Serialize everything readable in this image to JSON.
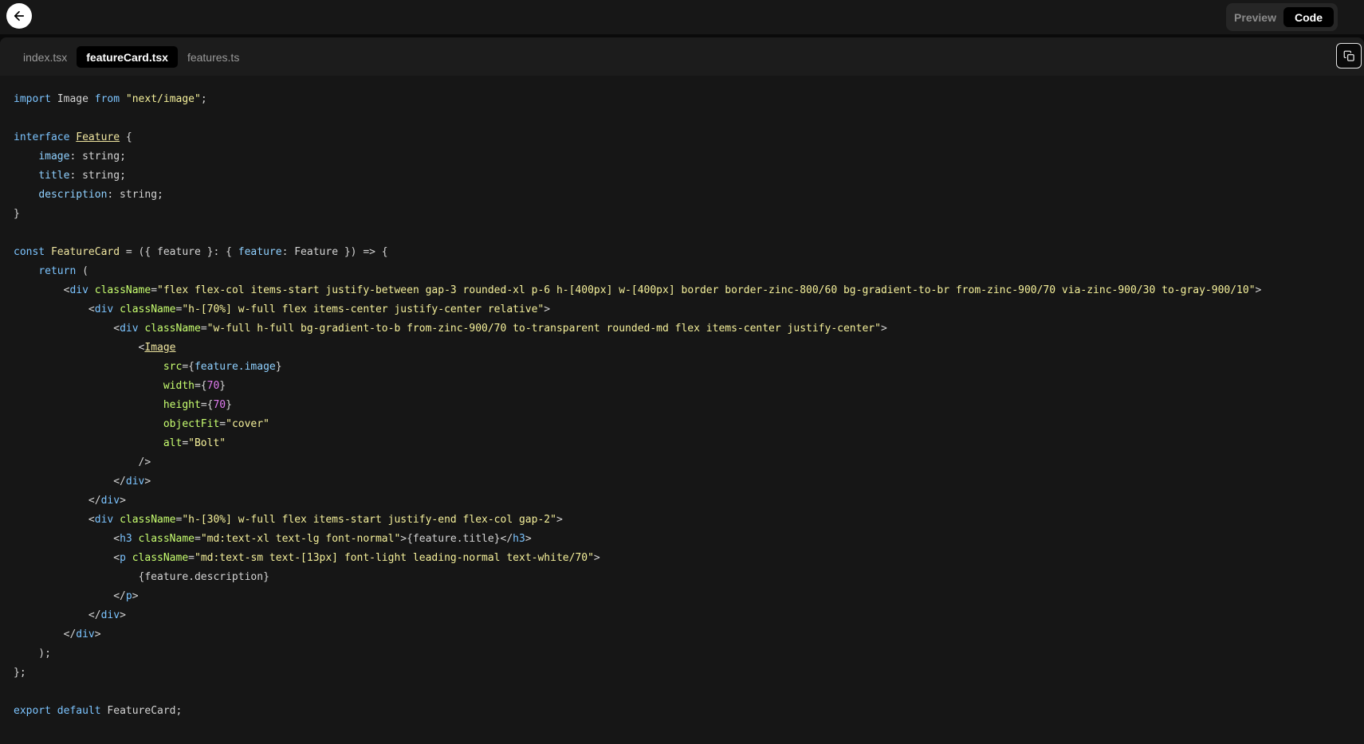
{
  "header": {
    "preview_label": "Preview",
    "code_label": "Code"
  },
  "tabs": [
    {
      "label": "index.tsx",
      "active": false
    },
    {
      "label": "featureCard.tsx",
      "active": true
    },
    {
      "label": "features.ts",
      "active": false
    }
  ],
  "code": {
    "lines": [
      "import Image from \"next/image\";",
      "",
      "interface Feature {",
      "    image: string;",
      "    title: string;",
      "    description: string;",
      "}",
      "",
      "const FeatureCard = ({ feature }: { feature: Feature }) => {",
      "    return (",
      "        <div className=\"flex flex-col items-start justify-between gap-3 rounded-xl p-6 h-[400px] w-[400px] border border-zinc-800/60 bg-gradient-to-br from-zinc-900/70 via-zinc-900/30 to-gray-900/10\">",
      "            <div className=\"h-[70%] w-full flex items-center justify-center relative\">",
      "                <div className=\"w-full h-full bg-gradient-to-b from-zinc-900/70 to-transparent rounded-md flex items-center justify-center\">",
      "                    <Image",
      "                        src={feature.image}",
      "                        width={70}",
      "                        height={70}",
      "                        objectFit=\"cover\"",
      "                        alt=\"Bolt\"",
      "                    />",
      "                </div>",
      "            </div>",
      "            <div className=\"h-[30%] w-full flex items-start justify-end flex-col gap-2\">",
      "                <h3 className=\"md:text-xl text-lg font-normal\">{feature.title}</h3>",
      "                <p className=\"md:text-sm text-[13px] font-light leading-normal text-white/70\">",
      "                    {feature.description}",
      "                </p>",
      "            </div>",
      "        </div>",
      "    );",
      "};",
      "",
      "export default FeatureCard;"
    ]
  },
  "icons": {
    "back": "arrow-left-icon",
    "copy": "copy-icon"
  },
  "colors": {
    "keyword": "#7cc4ff",
    "string": "#f5f09a",
    "attribute": "#c8ff70",
    "number": "#e07cf0"
  }
}
